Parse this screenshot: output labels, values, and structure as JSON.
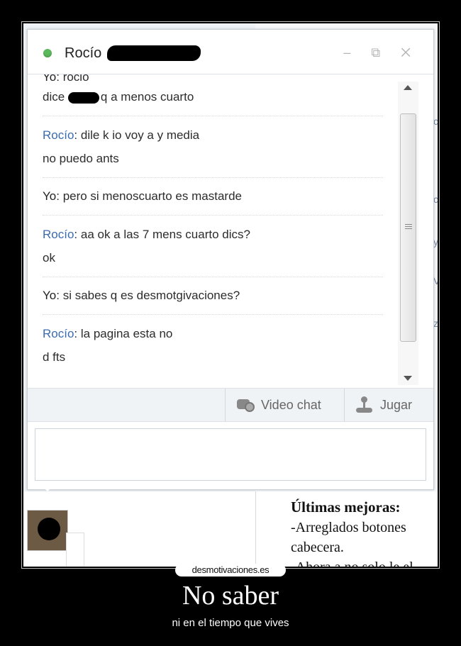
{
  "chat": {
    "contact_name": "Rocío",
    "window_controls": "– ⧉ ✕",
    "messages": [
      {
        "who": "Yo",
        "text": "rocio",
        "partial": true
      },
      {
        "who": "",
        "text": "dice",
        "after_redact": "q a menos cuarto"
      },
      {
        "who": "Rocío",
        "text": "dile k io voy a y media"
      },
      {
        "who": "",
        "text": "no puedo ants"
      },
      {
        "who": "Yo",
        "text": "pero si menoscuarto es mastarde"
      },
      {
        "who": "Rocío",
        "text": "aa ok a las 7 mens cuarto dics?"
      },
      {
        "who": "",
        "text": "ok"
      },
      {
        "who": "Yo",
        "text": "si sabes q es desmotgivaciones?"
      },
      {
        "who": "Rocío",
        "text": "la pagina esta no"
      },
      {
        "who": "",
        "text": "d fts"
      }
    ],
    "toolbar": {
      "video_label": "Video chat",
      "game_label": "Jugar"
    }
  },
  "background": {
    "improvements_title": "Últimas mejoras:",
    "improvements_lines": [
      "-Arreglados botones",
      "cabecera.",
      "-Ahora a no solo le el"
    ]
  },
  "poster": {
    "watermark": "desmotivaciones.es",
    "title": "No saber",
    "subtitle": "ni en el tiempo que vives"
  }
}
